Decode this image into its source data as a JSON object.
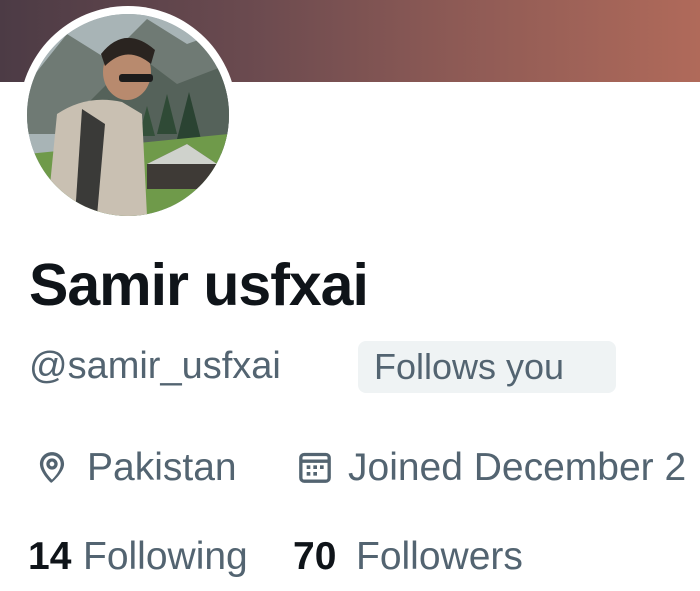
{
  "profile": {
    "display_name": "Samir usfxai",
    "handle": "@samir_usfxai",
    "follows_you_badge": "Follows you",
    "location": "Pakistan",
    "joined": "Joined December 2",
    "following_count": "14",
    "following_label": "Following",
    "followers_count": "70",
    "followers_label": "Followers"
  },
  "icons": {
    "location": "location-pin-icon",
    "joined": "calendar-icon"
  },
  "colors": {
    "text_primary": "#0f1419",
    "text_secondary": "#536471",
    "badge_bg": "#eff3f4"
  }
}
